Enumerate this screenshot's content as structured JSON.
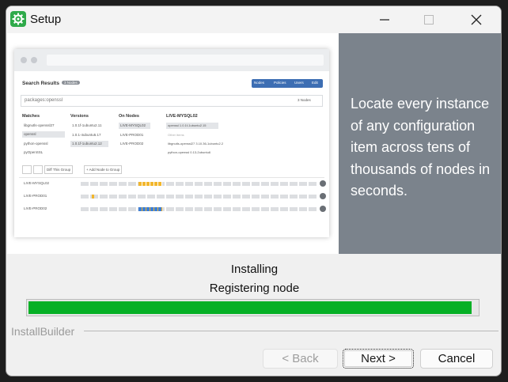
{
  "window": {
    "title": "Setup"
  },
  "banner": {
    "text": "Locate every instance of any configuration item across tens of thousands of nodes in seconds.",
    "mockup": {
      "search_title": "Search Results",
      "badge": "3 Nodes",
      "tabs": [
        "Nodes",
        "Policies",
        "Users",
        "Edit"
      ],
      "query": "packages:openssl",
      "nodes_count": "3 Nodes",
      "columns": [
        "Matches",
        "Versions",
        "On Nodes",
        "LIVE-MYSQL02"
      ],
      "matches": [
        "libgnutls-openssl27",
        "openssl",
        "python-openssl",
        "pyOpenSSL"
      ],
      "versions": [
        "1.0.1f-1ubuntu2.11",
        "1.0.1-4ubuntu5.17",
        "1.0.1f-1ubuntu2.12"
      ],
      "on_nodes": [
        "LIVE-MYSQL02",
        "LIVE-PROD01",
        "LIVE-PROD02"
      ],
      "detail": [
        "openssl 1.0.1f-1ubuntu2.15",
        "Other items",
        "libgnutls-openssl27 3.10.36-1ubuntu2.2",
        "python-openssl 0.13-2ubuntu6"
      ],
      "toolbar": [
        "Diff This Group",
        "+ Add Node to Group"
      ],
      "rows": [
        "LIVE-MYSQL02",
        "LIVE-PROD01",
        "LIVE-PROD02"
      ]
    }
  },
  "status": {
    "line1": "Installing",
    "line2": "Registering node"
  },
  "progress": {
    "value": 0.988
  },
  "brand": "InstallBuilder",
  "buttons": {
    "back": "< Back",
    "next": "Next >",
    "cancel": "Cancel"
  },
  "colors": {
    "progress": "#06b025",
    "side_panel": "#7b838c",
    "app_icon": "#2faa4a"
  }
}
